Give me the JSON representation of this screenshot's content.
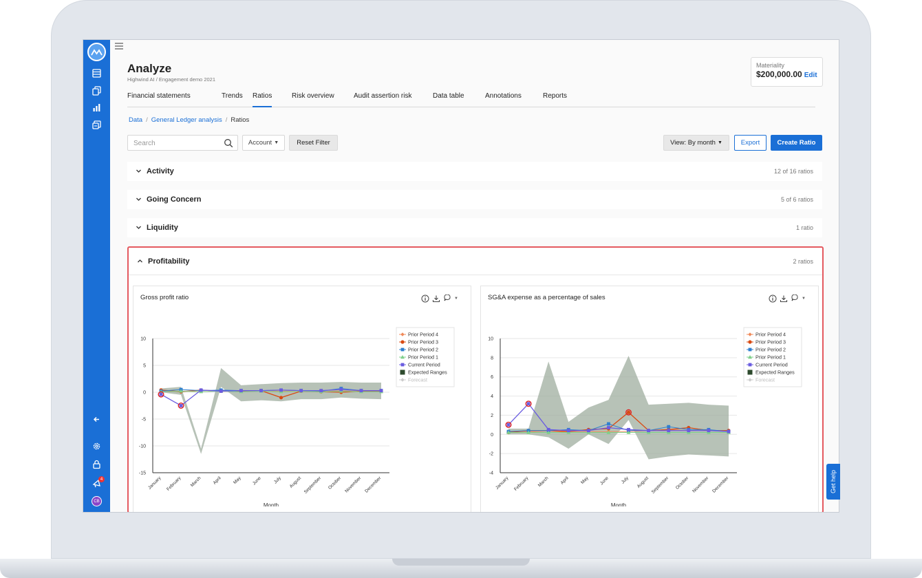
{
  "app": {
    "page_title": "Analyze",
    "page_subtitle": "Highwind AI / Engagement demo 2021",
    "user_initials": "CB",
    "notification_count": "4"
  },
  "materiality": {
    "label": "Materiality",
    "value": "$200,000.00",
    "edit_label": "Edit"
  },
  "tabs": [
    {
      "label": "Financial statements",
      "active": false
    },
    {
      "label": "Trends",
      "active": false
    },
    {
      "label": "Ratios",
      "active": true
    },
    {
      "label": "Risk overview",
      "active": false
    },
    {
      "label": "Audit assertion risk",
      "active": false
    },
    {
      "label": "Data table",
      "active": false
    },
    {
      "label": "Annotations",
      "active": false
    },
    {
      "label": "Reports",
      "active": false
    }
  ],
  "breadcrumb": [
    {
      "label": "Data",
      "link": true
    },
    {
      "label": "General Ledger analysis",
      "link": true
    },
    {
      "label": "Ratios",
      "link": false
    }
  ],
  "toolbar": {
    "search_placeholder": "Search",
    "account_label": "Account",
    "reset_label": "Reset Filter",
    "view_label": "View: By month",
    "export_label": "Export",
    "create_label": "Create Ratio"
  },
  "sections": [
    {
      "title": "Activity",
      "count": "12 of 16 ratios"
    },
    {
      "title": "Going Concern",
      "count": "5 of 6 ratios"
    },
    {
      "title": "Liquidity",
      "count": "1 ratio"
    }
  ],
  "profitability": {
    "title": "Profitability",
    "count": "2 ratios"
  },
  "get_help_label": "Get help",
  "colors": {
    "accent": "#1a6fd6",
    "highlight_border": "#e4595f",
    "prior_period_4": "#f08a5a",
    "prior_period_3": "#d94a12",
    "prior_period_2": "#2f7fd0",
    "prior_period_1": "#7fd08a",
    "current_period": "#6a5ce0",
    "expected_ranges": "#9fae9f",
    "forecast": "#cccccc"
  },
  "chart_data": [
    {
      "type": "line",
      "title": "Gross profit ratio",
      "xlabel": "Month",
      "ylabel": "",
      "ylim": [
        -15,
        10
      ],
      "yticks": [
        10,
        5,
        0,
        -5,
        -10,
        -15
      ],
      "categories": [
        "January",
        "February",
        "March",
        "April",
        "May",
        "June",
        "July",
        "August",
        "September",
        "October",
        "November",
        "December"
      ],
      "legend": [
        "Prior Period 4",
        "Prior Period 3",
        "Prior Period 2",
        "Prior Period 1",
        "Current Period",
        "Expected Ranges",
        "Forecast"
      ],
      "legend_position": "right",
      "grid": true,
      "expected_range": {
        "upper": [
          0.7,
          1.0,
          -10.5,
          4.5,
          1.3,
          1.5,
          1.7,
          1.8,
          1.8,
          1.9,
          1.8,
          1.8
        ],
        "lower": [
          0.0,
          -0.5,
          -11.5,
          1.0,
          -1.7,
          -1.5,
          -1.7,
          -1.3,
          -1.3,
          -1.0,
          -1.2,
          -1.3
        ]
      },
      "series": [
        {
          "name": "Prior Period 4",
          "values": [
            0.3,
            0.2,
            0.3,
            0.3,
            0.3,
            0.3,
            0.2,
            0.3,
            0.3,
            0.4,
            0.3,
            0.3
          ]
        },
        {
          "name": "Prior Period 3",
          "values": [
            0.4,
            0.1,
            0.4,
            0.2,
            0.2,
            0.3,
            -1.0,
            0.2,
            0.1,
            0.0,
            0.2,
            0.2
          ]
        },
        {
          "name": "Prior Period 2",
          "values": [
            0.2,
            0.5,
            0.3,
            0.4,
            0.3,
            0.3,
            0.4,
            0.3,
            0.2,
            0.7,
            0.3,
            0.3
          ]
        },
        {
          "name": "Prior Period 1",
          "values": [
            0.1,
            0.2,
            0.1,
            0.2,
            0.1,
            0.2,
            0.1,
            0.2,
            0.1,
            0.2,
            0.1,
            0.1
          ]
        },
        {
          "name": "Current Period",
          "values": [
            -0.4,
            -2.5,
            0.4,
            0.2,
            0.3,
            0.3,
            0.4,
            0.3,
            0.3,
            0.5,
            0.3,
            0.3
          ]
        }
      ],
      "anomalies": [
        {
          "series": "Current Period",
          "index": 0
        },
        {
          "series": "Current Period",
          "index": 1
        }
      ]
    },
    {
      "type": "line",
      "title": "SG&A expense as a percentage of sales",
      "xlabel": "Month",
      "ylabel": "",
      "ylim": [
        -4,
        10
      ],
      "yticks": [
        10,
        8,
        6,
        4,
        2,
        0,
        -2,
        -4
      ],
      "categories": [
        "January",
        "February",
        "March",
        "April",
        "May",
        "June",
        "July",
        "August",
        "September",
        "October",
        "November",
        "December"
      ],
      "legend": [
        "Prior Period 4",
        "Prior Period 3",
        "Prior Period 2",
        "Prior Period 1",
        "Current Period",
        "Expected Ranges",
        "Forecast"
      ],
      "legend_position": "right",
      "grid": true,
      "expected_range": {
        "upper": [
          0.6,
          0.6,
          7.6,
          1.3,
          2.8,
          3.6,
          8.2,
          3.1,
          3.2,
          3.3,
          3.1,
          3.0
        ],
        "lower": [
          0.0,
          0.0,
          -0.3,
          -1.5,
          0.0,
          -1.0,
          1.5,
          -2.6,
          -2.3,
          -2.1,
          -2.2,
          -2.3
        ]
      },
      "series": [
        {
          "name": "Prior Period 4",
          "values": [
            0.3,
            0.3,
            0.2,
            0.3,
            0.3,
            0.3,
            0.3,
            0.4,
            0.5,
            0.4,
            0.4,
            0.3
          ]
        },
        {
          "name": "Prior Period 3",
          "values": [
            0.2,
            0.4,
            0.4,
            0.3,
            0.5,
            0.6,
            2.3,
            0.4,
            0.5,
            0.7,
            0.4,
            0.4
          ]
        },
        {
          "name": "Prior Period 2",
          "values": [
            0.3,
            0.4,
            0.4,
            0.5,
            0.4,
            1.1,
            0.4,
            0.4,
            0.8,
            0.5,
            0.5,
            0.3
          ]
        },
        {
          "name": "Prior Period 1",
          "values": [
            0.2,
            0.2,
            0.2,
            0.2,
            0.2,
            0.2,
            0.2,
            0.2,
            0.2,
            0.2,
            0.2,
            0.2
          ]
        },
        {
          "name": "Current Period",
          "values": [
            1.0,
            3.2,
            0.5,
            0.4,
            0.4,
            0.7,
            0.5,
            0.4,
            0.4,
            0.4,
            0.4,
            0.3
          ]
        }
      ],
      "anomalies": [
        {
          "series": "Current Period",
          "index": 0
        },
        {
          "series": "Current Period",
          "index": 1
        },
        {
          "series": "Prior Period 3",
          "index": 6
        }
      ]
    }
  ]
}
